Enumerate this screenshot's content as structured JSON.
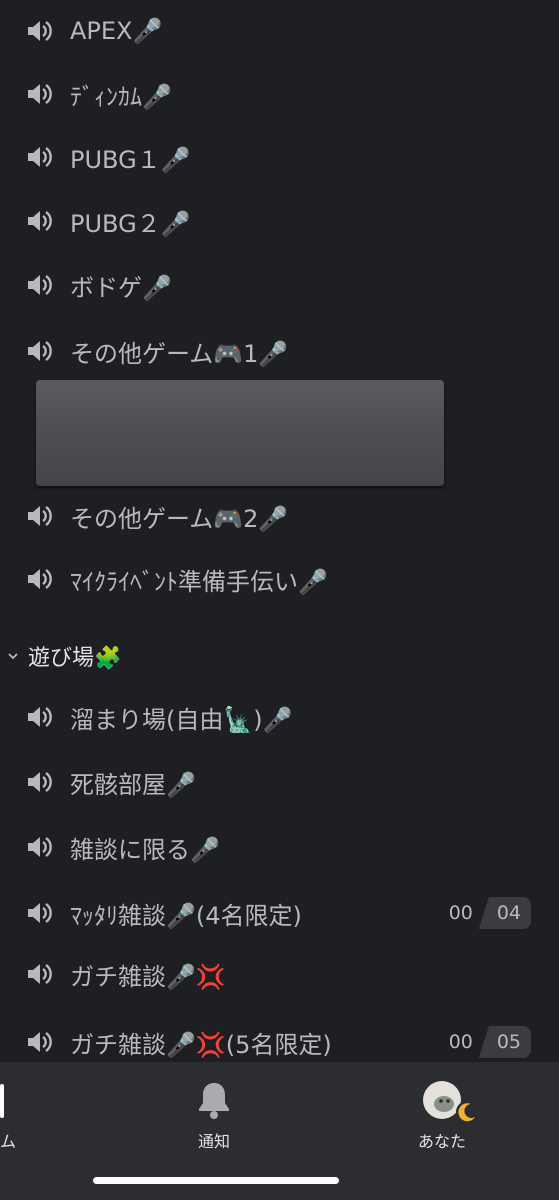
{
  "channels_top": [
    {
      "name": "APEX🎤"
    },
    {
      "name": "ﾃﾞｨﾝｶﾑ🎤"
    },
    {
      "name": "PUBG１🎤"
    },
    {
      "name": "PUBG２🎤"
    },
    {
      "name": "ボドゲ🎤"
    },
    {
      "name": "その他ゲーム🎮1🎤"
    }
  ],
  "channels_mid": [
    {
      "name": "その他ゲーム🎮2🎤"
    },
    {
      "name": "ﾏｲｸﾗｲﾍﾞﾝﾄ準備手伝い🎤"
    }
  ],
  "category": {
    "label": "遊び場🧩"
  },
  "channels_bottom": [
    {
      "name": "溜まり場(自由🗽)🎤"
    },
    {
      "name": "死骸部屋🎤"
    },
    {
      "name": "雑談に限る🎤"
    },
    {
      "name": "ﾏｯﾀﾘ雑談🎤(4名限定)",
      "count_current": "00",
      "count_limit": "04"
    },
    {
      "name": "ガチ雑談🎤💢"
    },
    {
      "name": "ガチ雑談🎤💢(5名限定)",
      "count_current": "00",
      "count_limit": "05"
    }
  ],
  "tabbar": {
    "home_label": "ム",
    "notifications_label": "通知",
    "you_label": "あなた"
  },
  "colors": {
    "background": "#1e1f22",
    "tabbar": "#2b2d31",
    "text": "#b7b9be"
  }
}
